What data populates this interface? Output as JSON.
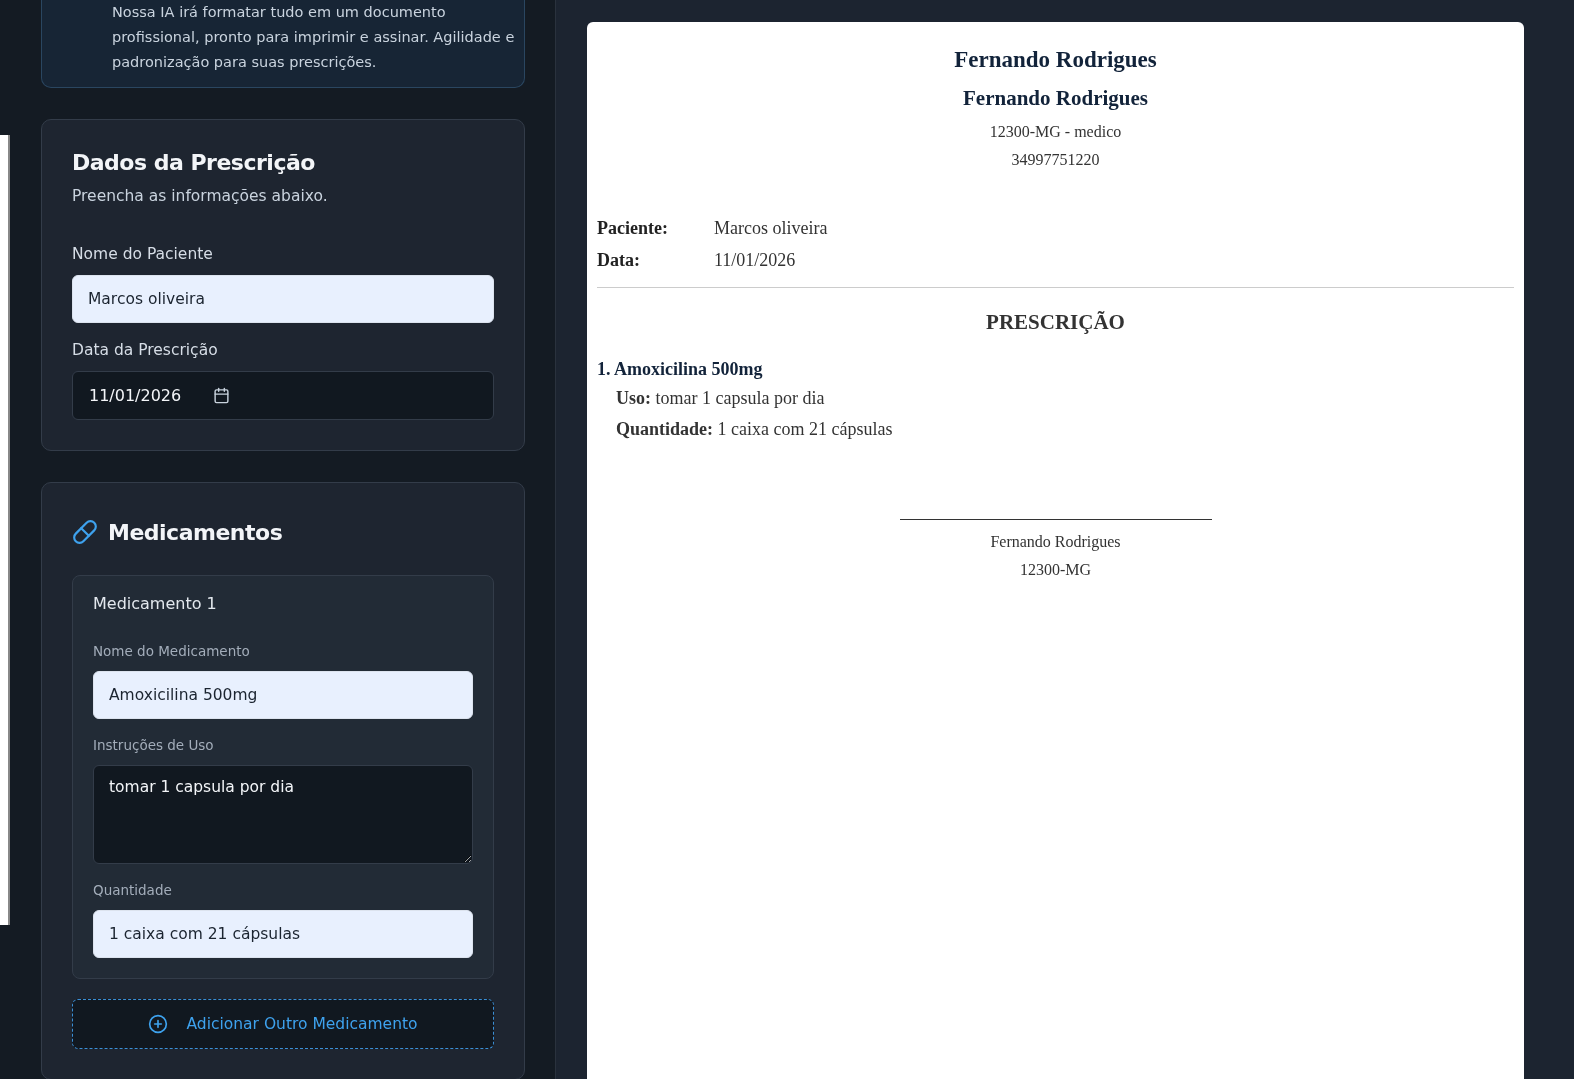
{
  "info_card": {
    "text": "Nossa IA irá formatar tudo em um documento profissional, pronto para imprimir e assinar. Agilidade e padronização para suas prescrições."
  },
  "prescription_form": {
    "title": "Dados da Prescrição",
    "subtitle": "Preencha as informações abaixo.",
    "fields": [
      {
        "kind": "text",
        "label": "Nome do Paciente",
        "value": "Marcos oliveira"
      },
      {
        "kind": "date",
        "label": "Data da Prescrição",
        "value": "11/01/2026"
      }
    ]
  },
  "medications_form": {
    "title": "Medicamentos",
    "items": [
      {
        "title": "Medicamento 1",
        "fields": [
          {
            "kind": "text",
            "label": "Nome do Medicamento",
            "value": "Amoxicilina 500mg"
          },
          {
            "kind": "textarea",
            "label": "Instruções de Uso",
            "value": "tomar 1 capsula por dia"
          },
          {
            "kind": "text",
            "label": "Quantidade",
            "value": "1 caixa com 21 cápsulas"
          }
        ]
      }
    ],
    "add_button": "Adicionar Outro Medicamento"
  },
  "document": {
    "header": [
      "Fernando Rodrigues",
      "Fernando Rodrigues",
      "12300-MG - medico",
      "34997751220"
    ],
    "info": [
      {
        "label": "Paciente:",
        "value": "Marcos oliveira"
      },
      {
        "label": "Data:",
        "value": "11/01/2026"
      }
    ],
    "section_title": "PRESCRIÇÃO",
    "items": [
      {
        "title": "1. Amoxicilina 500mg",
        "lines": [
          {
            "label": "Uso:",
            "value": "tomar 1 capsula por dia"
          },
          {
            "label": "Quantidade:",
            "value": "1 caixa com 21 cápsulas"
          }
        ]
      }
    ],
    "signature": [
      "Fernando Rodrigues",
      "12300-MG"
    ]
  }
}
